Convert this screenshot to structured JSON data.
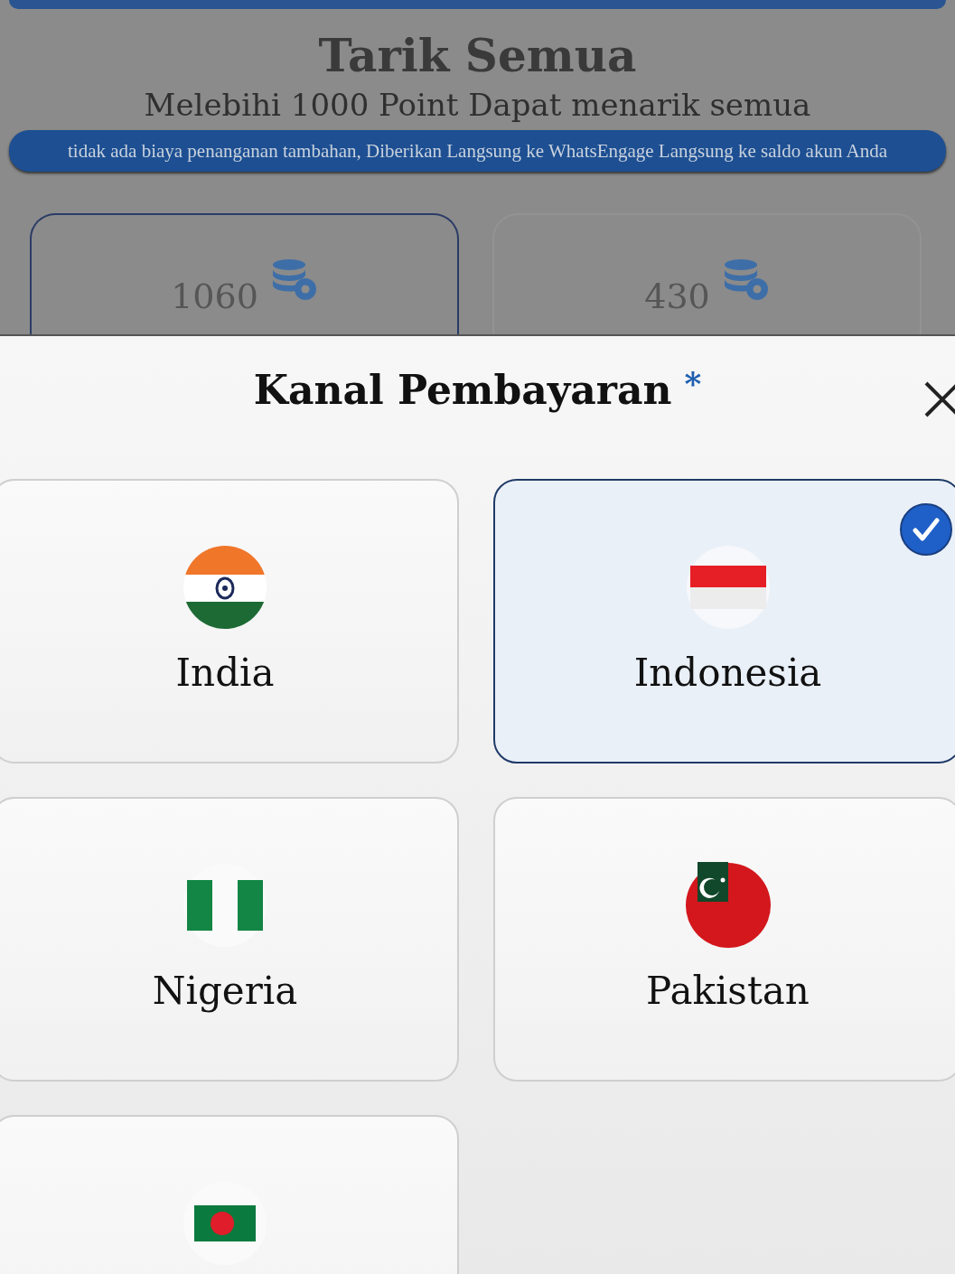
{
  "page": {
    "title": "Tarik Semua",
    "subtitle": "Melebihi 1000 Point Dapat menarik semua",
    "notice": "tidak ada biaya penanganan tambahan, Diberikan Langsung ke WhatsEngage Langsung ke saldo akun Anda",
    "balances": [
      {
        "amount": "1060",
        "selected": true
      },
      {
        "amount": "430",
        "selected": false
      }
    ]
  },
  "sheet": {
    "title": "Kanal Pembayaran",
    "required_mark": "*",
    "channels": [
      {
        "name": "India",
        "kind": "india",
        "selected": false
      },
      {
        "name": "Indonesia",
        "kind": "indonesia",
        "selected": true
      },
      {
        "name": "Nigeria",
        "kind": "nigeria",
        "selected": false
      },
      {
        "name": "Pakistan",
        "kind": "pakistan",
        "selected": false
      },
      {
        "kind": "bangladesh",
        "selected": false
      }
    ]
  }
}
